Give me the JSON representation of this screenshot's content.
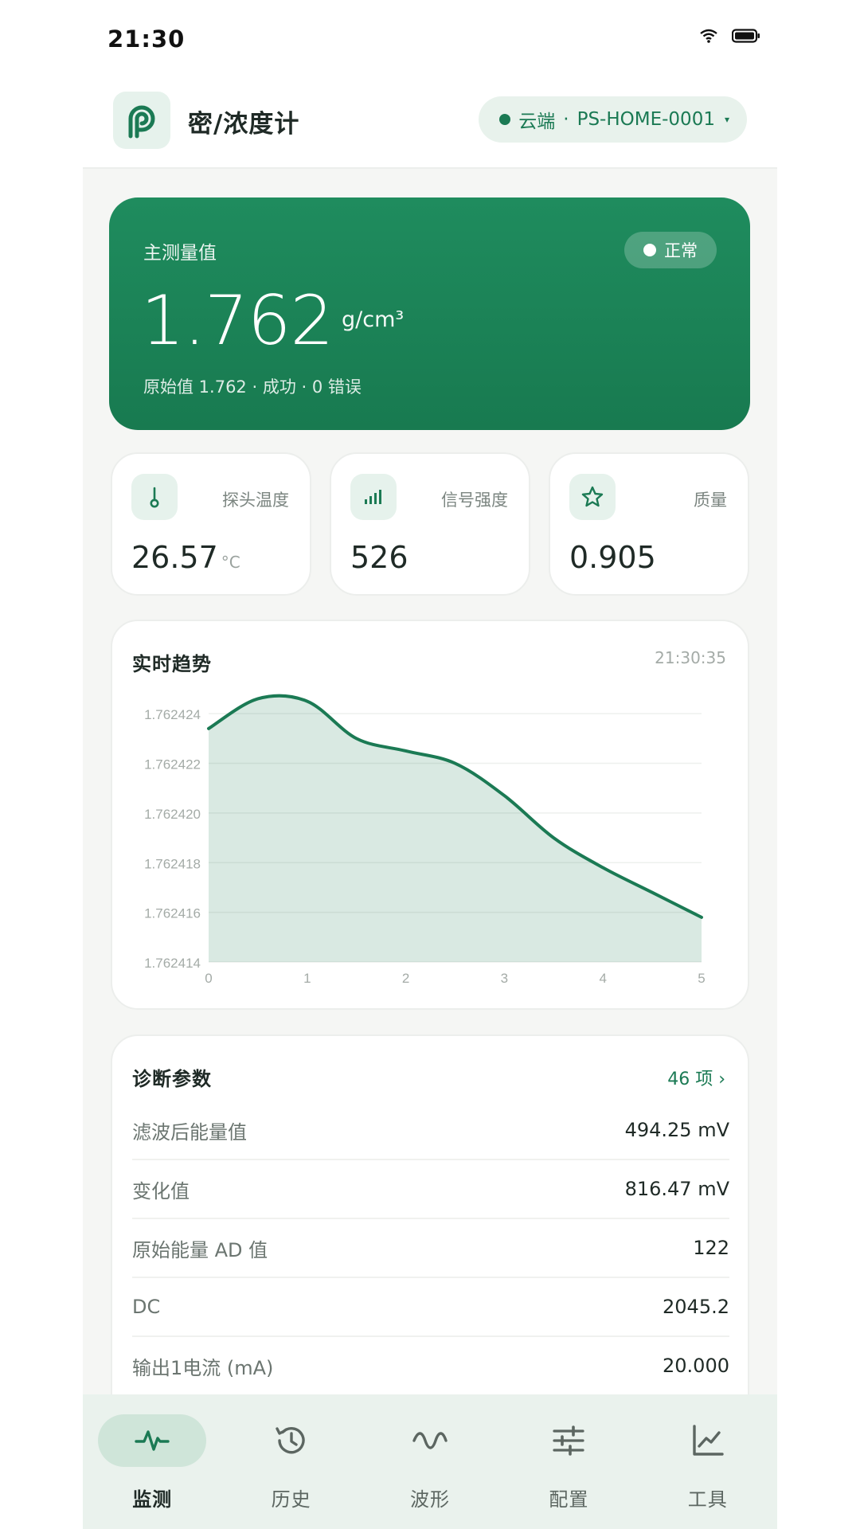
{
  "status_bar": {
    "time": "21:30"
  },
  "header": {
    "title": "密/浓度计",
    "device": {
      "source": "云端",
      "separator": "·",
      "id": "PS-HOME-0001",
      "caret": "▾"
    }
  },
  "hero": {
    "label": "主测量值",
    "status": "正常",
    "value": "1.762",
    "unit": "g/cm³",
    "sub": "原始值 1.762 · 成功 · 0 错误"
  },
  "metrics": [
    {
      "icon": "thermometer-icon",
      "label": "探头温度",
      "value": "26.57",
      "unit": "°C"
    },
    {
      "icon": "signal-bars-icon",
      "label": "信号强度",
      "value": "526",
      "unit": ""
    },
    {
      "icon": "star-icon",
      "label": "质量",
      "value": "0.905",
      "unit": ""
    }
  ],
  "trend": {
    "title": "实时趋势",
    "time": "21:30:35"
  },
  "chart_data": {
    "type": "area",
    "x": [
      0,
      0.5,
      1,
      1.5,
      2,
      2.5,
      3,
      3.5,
      4,
      4.5,
      5
    ],
    "y": [
      1.7624234,
      1.7624246,
      1.7624245,
      1.762423,
      1.7624225,
      1.762422,
      1.7624207,
      1.762419,
      1.7624178,
      1.7624168,
      1.7624158
    ],
    "x_ticks": [
      "0",
      "1",
      "2",
      "3",
      "4",
      "5"
    ],
    "y_ticks": [
      "1.762414",
      "1.762416",
      "1.762418",
      "1.762420",
      "1.762422",
      "1.762424"
    ],
    "xlim": [
      0,
      5
    ],
    "ylim": [
      1.762414,
      1.762425
    ],
    "grid": true,
    "color": "#1b7a54"
  },
  "diagnostics": {
    "title": "诊断参数",
    "count": "46 项 ›",
    "rows": [
      {
        "name": "滤波后能量值",
        "value": "494.25 mV"
      },
      {
        "name": "变化值",
        "value": "816.47 mV"
      },
      {
        "name": "原始能量 AD 值",
        "value": "122"
      },
      {
        "name": "DC",
        "value": "2045.2"
      },
      {
        "name": "输出1电流 (mA)",
        "value": "20.000"
      }
    ]
  },
  "nav": [
    {
      "label": "监测",
      "icon": "pulse-icon",
      "active": true
    },
    {
      "label": "历史",
      "icon": "history-icon",
      "active": false
    },
    {
      "label": "波形",
      "icon": "wave-icon",
      "active": false
    },
    {
      "label": "配置",
      "icon": "sliders-icon",
      "active": false
    },
    {
      "label": "工具",
      "icon": "line-chart-icon",
      "active": false
    }
  ],
  "colors": {
    "primary": "#1b7a54",
    "hero_top": "#1f8c5e",
    "hero_bottom": "#187a50",
    "nav_bg": "#eaf2ed"
  }
}
